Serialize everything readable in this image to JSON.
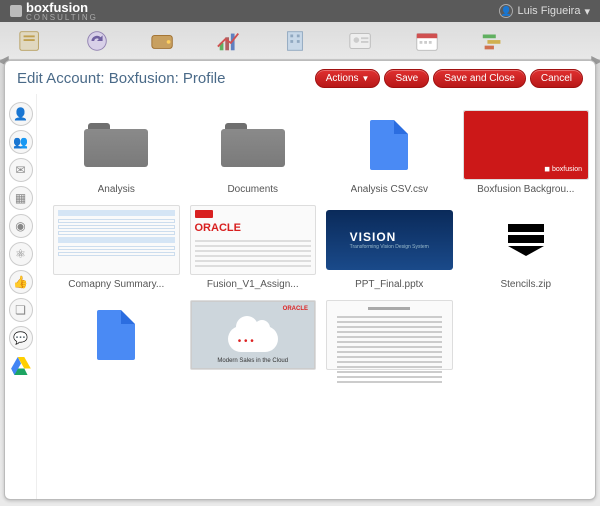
{
  "header": {
    "logo_main": "boxfusion",
    "logo_sub": "CONSULTING",
    "user_name": "Luis Figueira"
  },
  "panel": {
    "title": "Edit Account: Boxfusion: Profile",
    "actions_label": "Actions",
    "save_label": "Save",
    "save_close_label": "Save and Close",
    "cancel_label": "Cancel"
  },
  "files": [
    {
      "name": "Analysis",
      "kind": "folder"
    },
    {
      "name": "Documents",
      "kind": "folder"
    },
    {
      "name": "Analysis CSV.csv",
      "kind": "bluefile"
    },
    {
      "name": "Boxfusion Backgrou...",
      "kind": "redcard",
      "brand": "boxfusion"
    },
    {
      "name": "Comapny Summary...",
      "kind": "form"
    },
    {
      "name": "Fusion_V1_Assign...",
      "kind": "oracle",
      "logo": "ORACLE"
    },
    {
      "name": "PPT_Final.pptx",
      "kind": "vision",
      "vtitle": "VISION"
    },
    {
      "name": "Stencils.zip",
      "kind": "stencils"
    },
    {
      "name": "",
      "kind": "bluefile"
    },
    {
      "name": "",
      "kind": "cloud",
      "caption": "Modern Sales in the Cloud"
    },
    {
      "name": "",
      "kind": "textdoc"
    }
  ],
  "rail_icons": [
    "person",
    "group",
    "mail",
    "calendar",
    "camera",
    "network",
    "thumbs-up",
    "bookmark",
    "chat",
    "drive"
  ]
}
